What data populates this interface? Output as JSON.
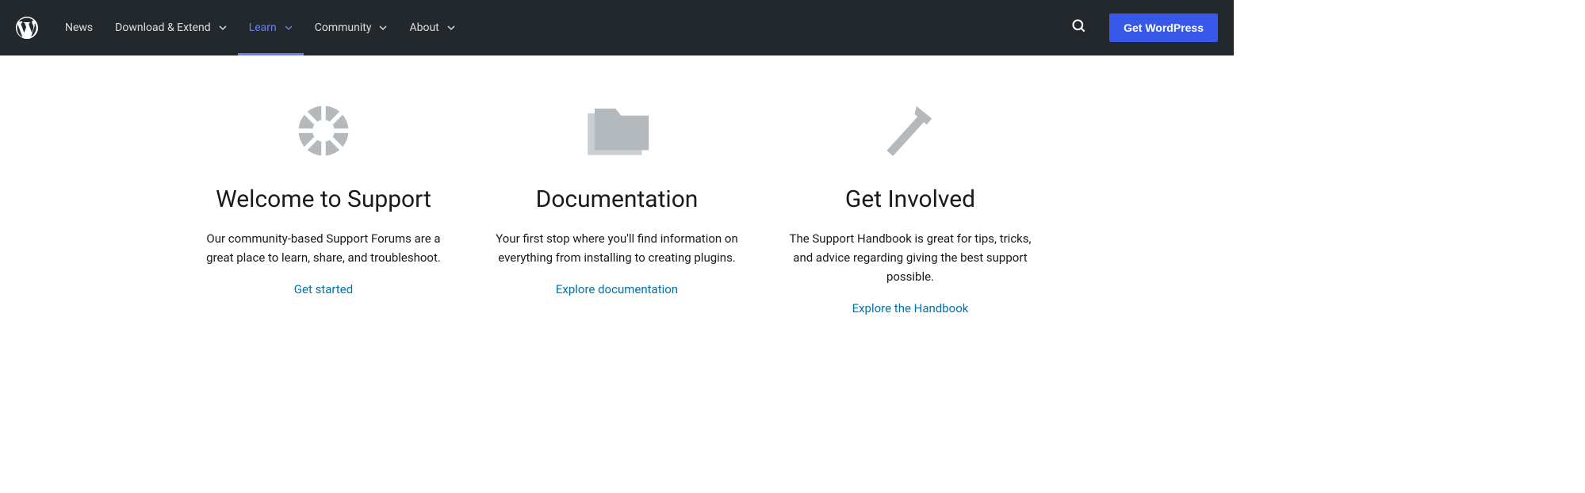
{
  "header": {
    "nav": [
      {
        "label": "News",
        "hasDropdown": false,
        "active": false
      },
      {
        "label": "Download & Extend",
        "hasDropdown": true,
        "active": false
      },
      {
        "label": "Learn",
        "hasDropdown": true,
        "active": true
      },
      {
        "label": "Community",
        "hasDropdown": true,
        "active": false
      },
      {
        "label": "About",
        "hasDropdown": true,
        "active": false
      }
    ],
    "cta": "Get WordPress"
  },
  "cards": [
    {
      "icon": "lifesaver-icon",
      "title": "Welcome to Support",
      "desc": "Our community-based Support Forums are a great place to learn, share, and troubleshoot.",
      "link": "Get started"
    },
    {
      "icon": "folder-icon",
      "title": "Documentation",
      "desc": "Your first stop where you'll find information on everything from installing to creating plugins.",
      "link": "Explore documentation"
    },
    {
      "icon": "hammer-icon",
      "title": "Get Involved",
      "desc": "The Support Handbook is great for tips, tricks, and advice regarding giving the best support possible.",
      "link": "Explore the Handbook"
    }
  ]
}
